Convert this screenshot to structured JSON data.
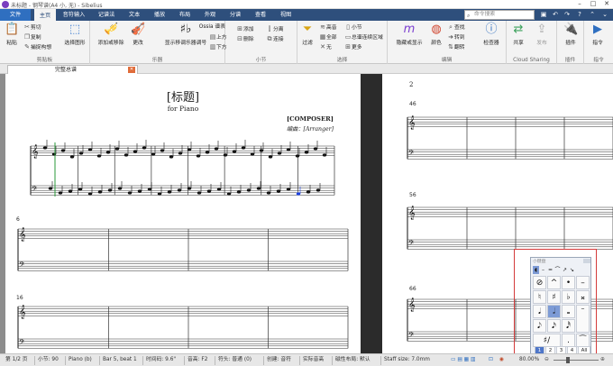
{
  "window": {
    "title": "未标题 - 钢琴谱(A4 小, 无) - Sibelius"
  },
  "tabs": [
    {
      "label": "文件"
    },
    {
      "label": "主页"
    },
    {
      "label": "音符输入"
    },
    {
      "label": "记谱法"
    },
    {
      "label": "文本"
    },
    {
      "label": "播放"
    },
    {
      "label": "布局"
    },
    {
      "label": "外观"
    },
    {
      "label": "分谱"
    },
    {
      "label": "查看"
    },
    {
      "label": "视图"
    }
  ],
  "search": {
    "placeholder": "命令搜索"
  },
  "ribbon": {
    "clipboard": {
      "label": "剪贴板",
      "paste": "粘贴",
      "cut": "剪切",
      "copy": "复制",
      "format_painter": "捕捉构想",
      "select_graphic": "选择图形"
    },
    "instruments": {
      "label": "乐器",
      "add_remove": "添加或移除",
      "change": "更改",
      "show_staves": "显示移调乐器调号"
    },
    "bars": {
      "label": "小节",
      "ossia": "Ossia 谱表",
      "above": "上方",
      "below": "下方",
      "add": "添加",
      "delete": "删除",
      "split": "分离",
      "join": "连接"
    },
    "selection": {
      "label": "选择",
      "filter": "过滤",
      "all": "全部",
      "none": "无",
      "high": "高音",
      "bar": "小节",
      "passage": "总谱连续区域",
      "more": "更多"
    },
    "edit": {
      "label": "编辑",
      "hide_show": "隐藏或显示",
      "color": "颜色",
      "find": "查找",
      "goto": "转到",
      "flip": "翻转",
      "inspector": "检查器"
    },
    "cloud": {
      "label": "Cloud Sharing",
      "share": "共享",
      "publish": "发布"
    },
    "plugins": {
      "label": "插件",
      "plugin": "插件"
    },
    "commands": {
      "label": "指令",
      "command": "指令"
    }
  },
  "document_tab": {
    "label": "完整总谱"
  },
  "score": {
    "title": "[标题]",
    "subtitle": "for Piano",
    "composer": "[COMPOSER]",
    "arranger": "编曲：[Arranger]",
    "page2_number": "2",
    "bar_numbers_left": [
      "6",
      "16"
    ],
    "bar_numbers_right": [
      "46",
      "56",
      "66"
    ]
  },
  "keypad": {
    "title": "小键盘",
    "tabs": [
      "1",
      "2",
      "3",
      "4",
      "All"
    ],
    "rows": [
      [
        "⊘",
        "^",
        "•",
        "–"
      ],
      [
        "♮",
        "♯",
        "♭",
        "𝄪"
      ],
      [
        "𝅘𝅥",
        "𝅗𝅥",
        "𝅝",
        "𝄻"
      ],
      [
        "𝅘𝅥𝅮",
        "𝅘𝅥𝅯",
        "𝅘𝅥𝅰",
        ""
      ],
      [
        "♯/",
        "·",
        ".",
        "⁀"
      ]
    ],
    "top_row": [
      "◖",
      "–",
      "=",
      "⌒",
      "↗",
      "↘"
    ]
  },
  "status": {
    "page": "第 1/2 页",
    "bar_count": "小节: 90",
    "instrument": "Piano (b)",
    "position": "Bar 5, beat 1",
    "time": "时间码: 9.6\"",
    "pitch": "音高: F2",
    "mode": "符头: 普通 (0)",
    "create": "创建: 音符",
    "concert": "实际音高",
    "layout": "磁性布局: 默认",
    "staff_size": "Staff size: 7.0mm",
    "zoom": "80.00%"
  },
  "colors": {
    "tab_bar": "#2e4f7c",
    "file_tab": "#2f6fc0",
    "keypad_border": "#d43b3b",
    "selection_blue": "#1a3fe0"
  }
}
